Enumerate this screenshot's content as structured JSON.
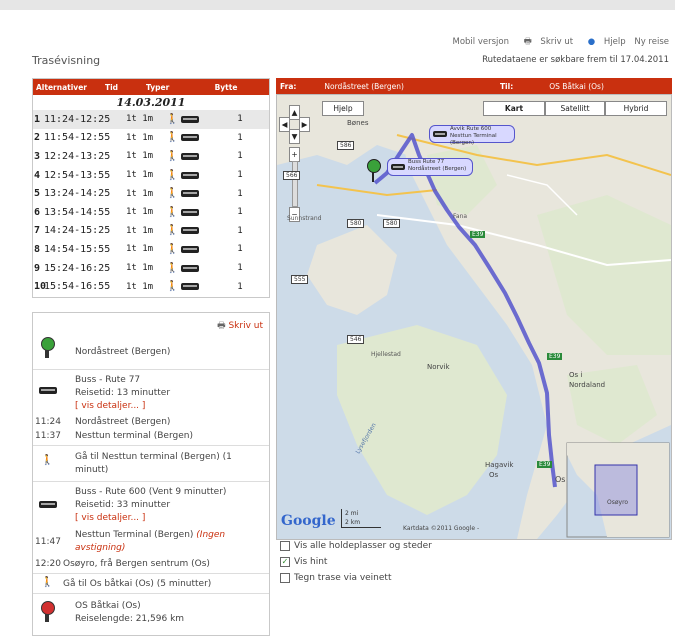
{
  "top_links": {
    "mobile": "Mobil versjon",
    "print": "Skriv ut",
    "help": "Hjelp",
    "new_trip": "Ny reise"
  },
  "page_title": "Trasévisning",
  "route_data_note": "Rutedataene er søkbare frem til 17.04.2011",
  "alternatives": {
    "headers": [
      "Alternativer",
      "Tid",
      "Typer",
      "Bytte"
    ],
    "date": "14.03.2011",
    "rows": [
      {
        "num": "1",
        "time": "11:24-12:25",
        "duration": "1t 1m",
        "changes": "1"
      },
      {
        "num": "2",
        "time": "11:54-12:55",
        "duration": "1t 1m",
        "changes": "1"
      },
      {
        "num": "3",
        "time": "12:24-13:25",
        "duration": "1t 1m",
        "changes": "1"
      },
      {
        "num": "4",
        "time": "12:54-13:55",
        "duration": "1t 1m",
        "changes": "1"
      },
      {
        "num": "5",
        "time": "13:24-14:25",
        "duration": "1t 1m",
        "changes": "1"
      },
      {
        "num": "6",
        "time": "13:54-14:55",
        "duration": "1t 1m",
        "changes": "1"
      },
      {
        "num": "7",
        "time": "14:24-15:25",
        "duration": "1t 1m",
        "changes": "1"
      },
      {
        "num": "8",
        "time": "14:54-15:55",
        "duration": "1t 1m",
        "changes": "1"
      },
      {
        "num": "9",
        "time": "15:24-16:25",
        "duration": "1t 1m",
        "changes": "1"
      },
      {
        "num": "10",
        "time": "15:54-16:55",
        "duration": "1t 1m",
        "changes": "1"
      }
    ]
  },
  "details": {
    "print_label": "Skriv ut",
    "start": "Nordåstreet (Bergen)",
    "bus1_title": "Buss - Rute 77",
    "bus1_travel": "Reisetid: 13 minutter",
    "bus1_link": "[ vis detaljer... ]",
    "dep1_time": "11:24",
    "dep1_place": "Nordåstreet (Bergen)",
    "arr1_time": "11:37",
    "arr1_place": "Nesttun terminal (Bergen)",
    "walk1": "Gå til Nesttun terminal (Bergen) (1 minutt)",
    "bus2_title": "Buss - Rute 600 (Vent 9 minutter)",
    "bus2_travel": "Reisetid: 33 minutter",
    "bus2_link": "[ vis detaljer... ]",
    "dep2_time": "11:47",
    "dep2_place": "Nesttun Terminal (Bergen)",
    "dep2_note": "(Ingen avstigning)",
    "arr2_time": "12:20",
    "arr2_place": "Osøyro, frå Bergen sentrum (Os)",
    "walk2": "Gå til Os båtkai (Os) (5 minutter)",
    "end_place": "OS Båtkai (Os)",
    "trip_length": "Reiselengde: 21,596 km"
  },
  "map_header": {
    "from_label": "Fra:",
    "from_value": "Nordåstreet (Bergen)",
    "to_label": "Til:",
    "to_value": "OS Båtkai (Os)"
  },
  "map": {
    "help_btn": "Hjelp",
    "type_btns": [
      "Kart",
      "Satellitt",
      "Hybrid"
    ],
    "bubble1_l1": "Avvik Rute 600",
    "bubble1_l2": "Nesttun Terminal (Bergen)",
    "bubble2_l1": "Buss Rute 77",
    "bubble2_l2": "Nordåstreet (Bergen)",
    "scale_l1": "2 mi",
    "scale_l2": "2 km",
    "copyright": "Kartdata ©2011 Google -",
    "google": "Google",
    "labels": {
      "bones": "Bønes",
      "os": "Os",
      "os_i": "Os i",
      "nordaland": "Nordaland",
      "norvik": "Norvik",
      "hagavik": "Hagavik",
      "os_small": "Os",
      "lysefjorden": "Lysefjorden",
      "sundstrand": "Sunnstrand",
      "osøyro": "Osøyro",
      "hjellestad": "Hjellestad",
      "fana": "Fana"
    },
    "roads": [
      "586",
      "580",
      "580",
      "555",
      "546",
      "566",
      "E39",
      "E39",
      "E39"
    ],
    "water_color": "#cddbe8",
    "land_color": "#e8e6dc",
    "route_color": "#5555cc"
  },
  "options": [
    {
      "label": "Vis alle holdeplasser og steder",
      "checked": false
    },
    {
      "label": "Vis hint",
      "checked": true
    },
    {
      "label": "Tegn trase via veinett",
      "checked": false
    }
  ]
}
